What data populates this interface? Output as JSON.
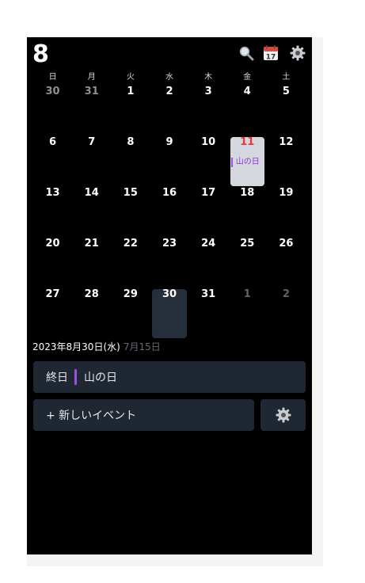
{
  "header": {
    "month": "8",
    "calendar_icon_day": "17",
    "icons": [
      "search-icon",
      "calendar-today-icon",
      "gear-icon"
    ]
  },
  "weekdays": [
    "日",
    "月",
    "火",
    "水",
    "木",
    "金",
    "土"
  ],
  "weeks": [
    [
      "30",
      "31",
      "1",
      "2",
      "3",
      "4",
      "5"
    ],
    [
      "6",
      "7",
      "8",
      "9",
      "10",
      "11",
      "12"
    ],
    [
      "13",
      "14",
      "15",
      "16",
      "17",
      "18",
      "19"
    ],
    [
      "20",
      "21",
      "22",
      "23",
      "24",
      "25",
      "26"
    ],
    [
      "27",
      "28",
      "29",
      "30",
      "31",
      "1",
      "2"
    ]
  ],
  "holiday_event": {
    "day": "11",
    "label": "山の日"
  },
  "selected_date": {
    "label": "2023年8月30日(水)",
    "lunar": "7月15日"
  },
  "events": [
    {
      "time": "終日",
      "title": "山の日"
    }
  ],
  "new_event_label": "+ 新しいイベント",
  "colors": {
    "background": "#000000",
    "card": "#1f2733",
    "today_highlight": "#d4d7de",
    "selected_highlight": "#252e3b",
    "holiday_red": "#e53935",
    "event_purple": "#a24ce6"
  }
}
